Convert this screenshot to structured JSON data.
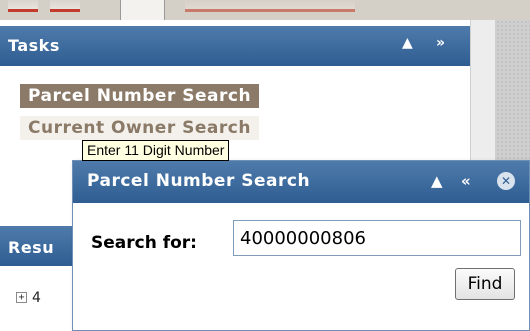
{
  "tasks_panel": {
    "title": "Tasks",
    "collapse_glyph": "▲",
    "expand_glyph": "»",
    "items": [
      {
        "label": "Parcel Number Search"
      },
      {
        "label": "Current Owner Search"
      }
    ]
  },
  "tooltip": {
    "text": "Enter 11 Digit Number"
  },
  "search_panel": {
    "title": "Parcel Number Search",
    "collapse_glyph": "▲",
    "dock_glyph": "«",
    "close_glyph": "✕",
    "label": "Search for:",
    "value": "40000000806",
    "find_label": "Find"
  },
  "results_panel": {
    "title": "Resu",
    "expand_glyph": "+",
    "first_item": "4"
  },
  "colors": {
    "header_top": "#4f7bab",
    "header_bottom": "#2f5d92",
    "task_active_bg": "#8a7a67",
    "task_text": "#8a7a67",
    "tooltip_bg": "#ffffe1"
  },
  "icons": {
    "collapse": "triangle-up-icon",
    "expand": "double-chevron-right-icon",
    "dock": "double-chevron-left-icon",
    "close": "close-circle-icon",
    "tree_expand": "plus-box-icon"
  }
}
